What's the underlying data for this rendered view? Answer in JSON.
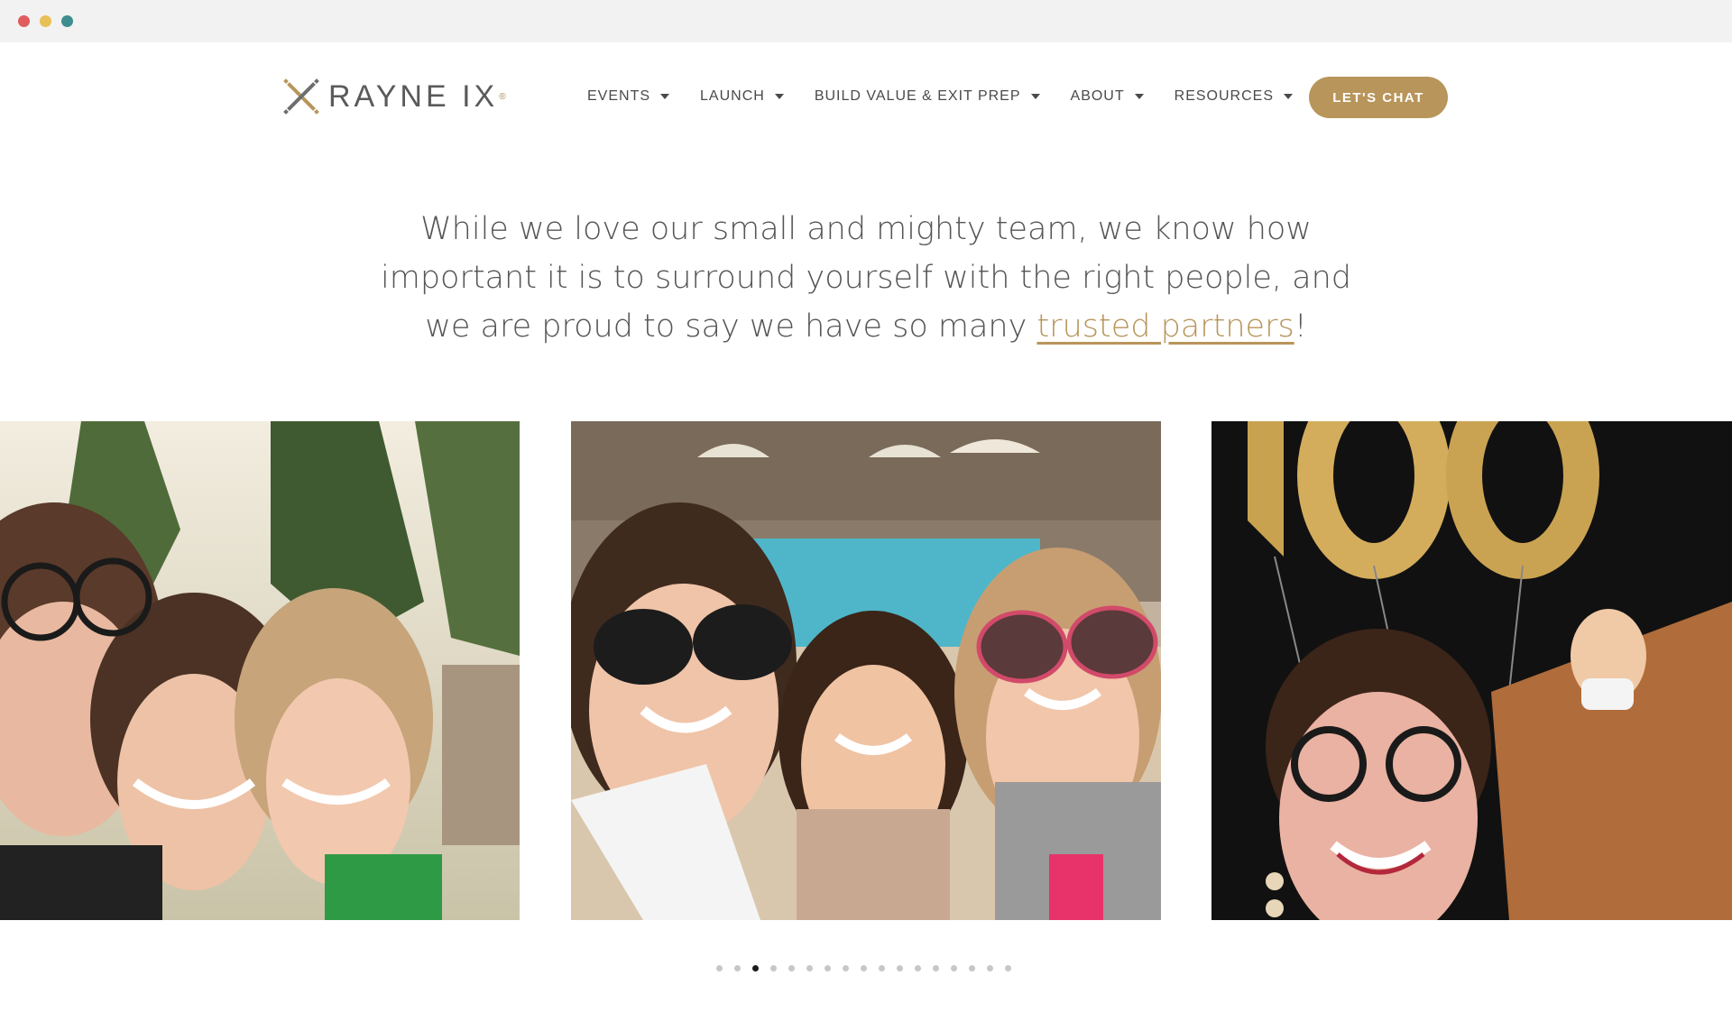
{
  "window": {
    "controls": [
      "close",
      "minimize",
      "zoom"
    ]
  },
  "brand": {
    "name": "RAYNE IX",
    "registered": "®",
    "accent": "#b8955a",
    "text_color": "#5a5a5a"
  },
  "nav": {
    "items": [
      {
        "label": "EVENTS"
      },
      {
        "label": "LAUNCH"
      },
      {
        "label": "BUILD VALUE & EXIT PREP"
      },
      {
        "label": "ABOUT"
      },
      {
        "label": "RESOURCES"
      }
    ],
    "cta_label": "LET'S CHAT"
  },
  "intro": {
    "text_before": "While we love our small and mighty team, we know how important it is to surround yourself with the right people, and we are proud to say we have so many ",
    "link_text": "trusted partners",
    "text_after": "!"
  },
  "carousel": {
    "photos": [
      {
        "alt": "three-women-selfie-outdoors"
      },
      {
        "alt": "three-women-selfie-by-pool"
      },
      {
        "alt": "woman-with-gold-balloons"
      }
    ],
    "pagination": {
      "total": 17,
      "active": 3
    }
  }
}
